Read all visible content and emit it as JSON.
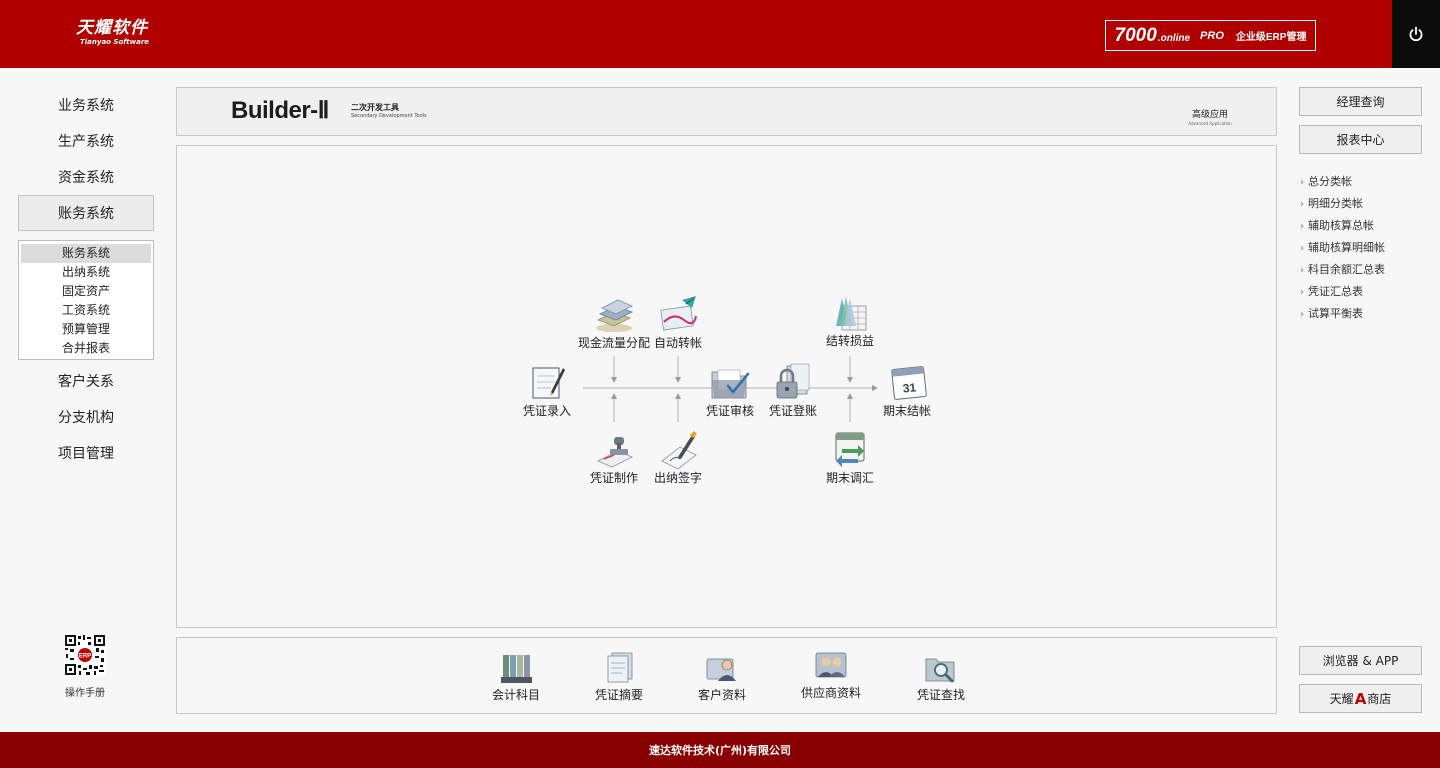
{
  "header": {
    "logo_cn": "天耀软件",
    "logo_en": "Tianyao Software",
    "edition_number": "7000",
    "edition_online": ".online",
    "edition_pro": "PRO",
    "edition_enterprise": "企业级ERP管理",
    "power_icon": "power-icon"
  },
  "left_nav": {
    "items": [
      {
        "label": "业务系统"
      },
      {
        "label": "生产系统"
      },
      {
        "label": "资金系统"
      },
      {
        "label": "账务系统",
        "active": true
      },
      {
        "label": "客户关系"
      },
      {
        "label": "分支机构"
      },
      {
        "label": "项目管理"
      }
    ],
    "sub_items": [
      {
        "label": "账务系统",
        "active": true
      },
      {
        "label": "出纳系统"
      },
      {
        "label": "固定资产"
      },
      {
        "label": "工资系统"
      },
      {
        "label": "预算管理"
      },
      {
        "label": "合并报表"
      }
    ],
    "manual_label": "操作手册",
    "qr_badge": "ERP"
  },
  "banner": {
    "brand": "Builder-Ⅱ",
    "brand_sub_cn": "二次开发工具",
    "brand_sub_en": "Secondary Development Tools",
    "advanced_cn": "高级应用",
    "advanced_en": "Advanced Application"
  },
  "flow": {
    "cash_flow": {
      "label": "现金流量分配",
      "icon": "cash-stack-icon"
    },
    "auto_transfer": {
      "label": "自动转帐",
      "icon": "auto-transfer-icon"
    },
    "carry_forward": {
      "label": "结转损益",
      "icon": "carry-forward-icon"
    },
    "voucher_entry": {
      "label": "凭证录入",
      "icon": "voucher-entry-icon"
    },
    "voucher_audit": {
      "label": "凭证审核",
      "icon": "folder-check-icon"
    },
    "voucher_post": {
      "label": "凭证登账",
      "icon": "lock-icon"
    },
    "period_close": {
      "label": "期末结帐",
      "icon": "calendar-icon",
      "day": "31"
    },
    "voucher_make": {
      "label": "凭证制作",
      "icon": "stamp-icon"
    },
    "cashier_sign": {
      "label": "出纳签字",
      "icon": "pen-sign-icon"
    },
    "period_fx": {
      "label": "期末调汇",
      "icon": "calendar-arrows-icon"
    }
  },
  "tools": [
    {
      "label": "会计科目",
      "icon": "ledger-binders-icon"
    },
    {
      "label": "凭证摘要",
      "icon": "document-stack-icon"
    },
    {
      "label": "客户资料",
      "icon": "customer-card-icon"
    },
    {
      "label": "供应商资料",
      "icon": "suppliers-icon"
    },
    {
      "label": "凭证查找",
      "icon": "folder-search-icon"
    }
  ],
  "right": {
    "manager_query": "经理查询",
    "report_center": "报表中心",
    "reports": [
      {
        "label": "总分类帐"
      },
      {
        "label": "明细分类帐"
      },
      {
        "label": "辅助核算总帐"
      },
      {
        "label": "辅助核算明细帐"
      },
      {
        "label": "科目余额汇总表"
      },
      {
        "label": "凭证汇总表"
      },
      {
        "label": "试算平衡表"
      }
    ],
    "browser_app": "浏览器 & APP",
    "store_prefix": "天耀",
    "store_mark": "A",
    "store_suffix": "商店"
  },
  "footer": {
    "text": "速达软件技术(广州)有限公司"
  },
  "colors": {
    "header_red": "#b00000",
    "footer_red": "#880000",
    "power_bg": "#0b0b0b"
  }
}
